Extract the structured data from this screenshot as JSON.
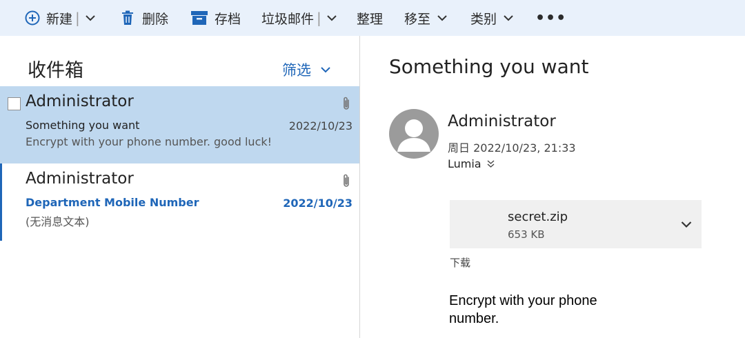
{
  "toolbar": {
    "new_label": "新建",
    "delete_label": "删除",
    "archive_label": "存档",
    "junk_label": "垃圾邮件",
    "sweep_label": "整理",
    "move_label": "移至",
    "category_label": "类别",
    "more_label": "•••"
  },
  "list": {
    "folder_title": "收件箱",
    "filter_label": "筛选",
    "messages": [
      {
        "sender": "Administrator",
        "subject": "Something you want",
        "preview": "Encrypt with your phone number. good luck!",
        "date": "2022/10/23",
        "selected": true,
        "has_attachment": true
      },
      {
        "sender": "Administrator",
        "subject": "Department Mobile Number",
        "preview": "(无消息文本)",
        "date": "2022/10/23",
        "unread": true,
        "has_attachment": true
      }
    ]
  },
  "reading": {
    "subject": "Something you want",
    "from": "Administrator",
    "datetime": "周日 2022/10/23, 21:33",
    "to": "Lumia",
    "attachment": {
      "name": "secret.zip",
      "size": "653 KB"
    },
    "download_label": "下载",
    "body": "Encrypt with your phone number."
  },
  "colors": {
    "accent": "#1f66b8",
    "toolbar_bg": "#e9f1fb",
    "selected_bg": "#bfd8ef"
  }
}
